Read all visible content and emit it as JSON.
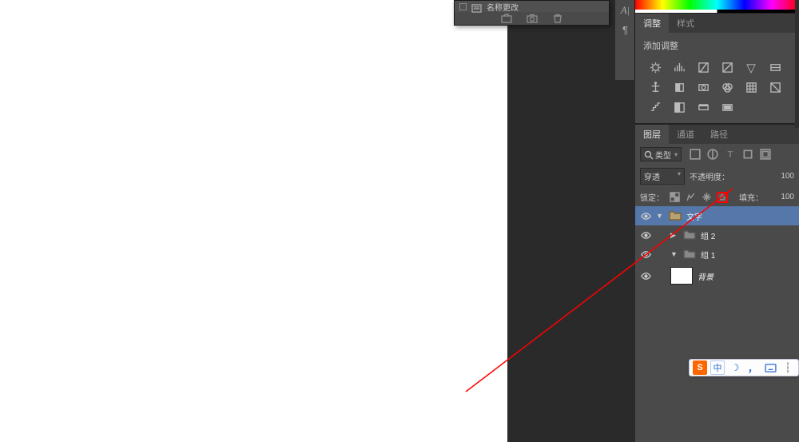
{
  "float_panel": {
    "title": "名称更改"
  },
  "adjustments": {
    "tab1": "调整",
    "tab2": "样式",
    "label": "添加调整"
  },
  "layers_tabs": {
    "layers": "图层",
    "channels": "通道",
    "paths": "路径"
  },
  "layers": {
    "filter_kind": "类型",
    "blend_mode": "穿透",
    "opacity_label": "不透明度：",
    "opacity_value": "100",
    "lock_label": "锁定：",
    "fill_label": "填充：",
    "fill_value": "100",
    "items": [
      {
        "name": "文字"
      },
      {
        "name": "组 2"
      },
      {
        "name": "组 1"
      },
      {
        "name": "背景"
      }
    ]
  },
  "ime": {
    "logo": "S",
    "lang": "中"
  }
}
